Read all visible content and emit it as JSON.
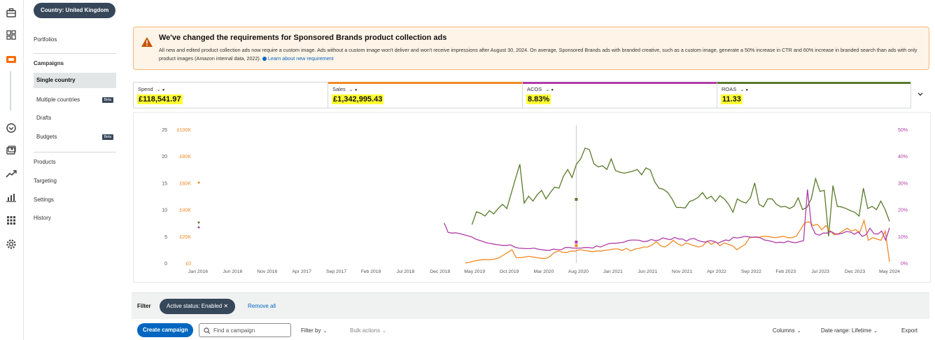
{
  "rail": {
    "icons": [
      "briefcase-icon",
      "dashboard-icon",
      "campaign-manager-icon",
      "shield-icon",
      "media-icon",
      "trending-icon",
      "bar-chart-icon",
      "apps-grid-icon",
      "settings-icon"
    ],
    "active_color": "#ff6a00"
  },
  "sidebar": {
    "country_pill": "Country: United Kingdom",
    "portfolios": "Portfolios",
    "campaigns_header": "Campaigns",
    "items": [
      {
        "label": "Single country",
        "selected": true
      },
      {
        "label": "Multiple countries",
        "badge": "Beta"
      },
      {
        "label": "Drafts"
      },
      {
        "label": "Budgets",
        "badge": "Beta"
      }
    ],
    "lower": [
      "Products",
      "Targeting",
      "Settings",
      "History"
    ]
  },
  "banner": {
    "title": "We've changed the requirements for Sponsored Brands product collection ads",
    "text": "All new and edited product collection ads now require a custom image. Ads without a custom image won't deliver and won't receive impressions after August 30, 2024. On average, Sponsored Brands ads with branded creative, such as a custom image, generate a 50% increase in CTR and 60% increase in branded search than ads with only product images (Amazon internal data, 2022).",
    "link": "Learn about new requirement",
    "accent": "#f5b87a",
    "background": "#fff4e8"
  },
  "metrics": [
    {
      "label": "Spend",
      "value": "£118,541.97",
      "color": "#ffffff"
    },
    {
      "label": "Sales",
      "value": "£1,342,995.43",
      "color": "#f08a24"
    },
    {
      "label": "ACOS",
      "value": "8.83%",
      "color": "#b03ca8"
    },
    {
      "label": "ROAS",
      "value": "11.33",
      "color": "#5a7a2a"
    }
  ],
  "chart_data": {
    "type": "line",
    "x_labels": [
      "Jan 2016",
      "Jun 2016",
      "Nov 2016",
      "Apr 2017",
      "Sep 2017",
      "Feb 2018",
      "Jul 2018",
      "Dec 2018",
      "May 2019",
      "Oct 2019",
      "Mar 2020",
      "Aug 2020",
      "Jan 2021",
      "Jun 2021",
      "Nov 2021",
      "Apr 2022",
      "Sep 2022",
      "Feb 2023",
      "Jul 2023",
      "Dec 2023",
      "May 2024"
    ],
    "left_axis_roas": [
      "25",
      "20",
      "15",
      "10",
      "5",
      "0"
    ],
    "left_axis_sales": [
      "£100K",
      "£80K",
      "£60K",
      "£40K",
      "£20K",
      "£0"
    ],
    "right_axis_acos": [
      "50%",
      "40%",
      "30%",
      "20%",
      "10%",
      "0%"
    ],
    "ylim_roas": [
      0,
      25
    ],
    "ylim_sales": [
      0,
      100000
    ],
    "ylim_acos": [
      0,
      50
    ],
    "series": [
      {
        "name": "ROAS",
        "color": "#5a7a2a",
        "values": [
          null,
          null,
          null,
          null,
          null,
          null,
          null,
          null,
          null,
          null,
          null,
          null,
          null,
          null,
          null,
          null,
          null,
          null,
          null,
          null,
          null,
          null,
          null,
          null,
          null,
          null,
          null,
          null,
          null,
          null,
          null,
          null,
          null,
          null,
          null,
          null,
          null,
          null,
          null,
          null,
          null,
          null,
          null,
          null,
          null,
          null,
          null,
          null,
          null,
          null,
          null,
          null,
          null,
          null,
          null,
          null,
          null,
          null,
          null,
          null,
          null,
          null,
          null,
          7.2,
          9.6,
          9.3,
          8.8,
          9.8,
          9.2,
          10.2,
          11.0,
          10.2,
          13.0,
          15.8,
          18.5,
          11.2,
          12.5,
          11.6,
          12.8,
          13.6,
          12.0,
          13.2,
          14.2,
          14.0,
          16.2,
          17.5,
          16.0,
          18.5,
          19.5,
          21.5,
          21.2,
          18.6,
          18.0,
          18.2,
          17.5,
          19.5,
          17.3,
          17.0,
          16.8,
          17.0,
          17.2,
          17.5,
          16.5,
          17.8,
          17.4,
          15.2,
          14.0,
          13.8,
          13.2,
          12.0,
          10.4,
          10.4,
          10.3,
          11.5,
          11.8,
          12.3,
          13.2,
          12.0,
          12.5,
          11.5,
          12.6,
          12.0,
          11.0,
          9.5,
          12.0,
          11.5,
          11.2,
          12.2,
          15.0,
          11.0,
          10.5,
          12.0,
          12.0,
          11.0,
          10.5,
          10.6,
          10.2,
          10.6,
          12.2,
          10.0,
          10.4,
          12.0,
          15.8,
          13.4,
          13.6,
          5.0,
          14.5,
          10.6,
          10.5,
          10.2,
          9.8,
          9.5,
          8.8,
          14.0,
          10.2,
          10.6,
          10.0,
          11.6,
          10.0,
          7.8
        ]
      },
      {
        "name": "Sales",
        "color": "#f08a24",
        "values": [
          null,
          null,
          null,
          null,
          null,
          null,
          null,
          null,
          null,
          null,
          null,
          null,
          null,
          null,
          null,
          null,
          null,
          null,
          null,
          null,
          null,
          null,
          null,
          null,
          null,
          null,
          null,
          null,
          null,
          null,
          null,
          null,
          null,
          null,
          null,
          null,
          null,
          null,
          null,
          null,
          null,
          null,
          null,
          null,
          null,
          null,
          null,
          null,
          null,
          null,
          null,
          null,
          null,
          null,
          null,
          null,
          null,
          null,
          null,
          null,
          null,
          null,
          null,
          0,
          500,
          1500,
          2000,
          2500,
          2500,
          2500,
          3000,
          4000,
          6000,
          8000,
          10000,
          4000,
          4000,
          4500,
          5000,
          4500,
          4000,
          3500,
          3500,
          5000,
          8000,
          9000,
          8000,
          8000,
          9000,
          9000,
          10000,
          9500,
          9000,
          8500,
          9000,
          9000,
          9500,
          10000,
          10500,
          10500,
          9500,
          11000,
          9000,
          10500,
          11000,
          12000,
          12000,
          13500,
          16000,
          13000,
          12000,
          14000,
          17000,
          14500,
          13000,
          15000,
          14000,
          13000,
          12000,
          13000,
          16500,
          14000,
          16000,
          13000,
          15000,
          14000,
          13000,
          10000,
          12000,
          14000,
          19000,
          19500,
          19000,
          20000,
          20000,
          19500,
          19000,
          19500,
          20000,
          19000,
          19000,
          20000,
          25000,
          30000,
          31000,
          28000,
          29000,
          25000,
          28000,
          24000,
          21000,
          22000,
          24000,
          26000,
          24000,
          25000,
          23000,
          32000,
          17000,
          19000,
          18000,
          17000,
          24000,
          1000
        ]
      },
      {
        "name": "ACOS",
        "color": "#b03ca8",
        "values": [
          null,
          null,
          null,
          null,
          null,
          null,
          null,
          null,
          null,
          null,
          null,
          null,
          null,
          null,
          null,
          null,
          null,
          null,
          null,
          null,
          null,
          null,
          null,
          null,
          null,
          null,
          null,
          null,
          null,
          null,
          null,
          null,
          null,
          null,
          null,
          null,
          null,
          null,
          null,
          null,
          null,
          null,
          null,
          null,
          null,
          null,
          null,
          null,
          null,
          null,
          null,
          null,
          null,
          null,
          null,
          null,
          null,
          null,
          null,
          null,
          null,
          null,
          null,
          15.0,
          11.5,
          11.2,
          11.3,
          11.0,
          10.6,
          10.2,
          9.8,
          9.0,
          8.5,
          8.0,
          7.5,
          7.3,
          7.0,
          6.8,
          6.6,
          6.6,
          6.8,
          6.0,
          5.6,
          5.5,
          5.4,
          5.4,
          5.6,
          5.2,
          5.0,
          4.8,
          4.8,
          5.2,
          5.0,
          5.0,
          5.8,
          5.8,
          5.6,
          5.6,
          5.6,
          5.8,
          5.8,
          5.6,
          6.4,
          6.0,
          6.6,
          7.2,
          7.4,
          7.4,
          7.6,
          7.8,
          8.4,
          8.6,
          8.6,
          8.5,
          8.0,
          8.2,
          8.8,
          8.4,
          8.6,
          9.4,
          9.0,
          8.8,
          9.6,
          9.0,
          9.0,
          8.2,
          9.0,
          9.2,
          8.4,
          8.0,
          7.8,
          8.4,
          8.2,
          7.4,
          8.0,
          8.6,
          8.4,
          9.6,
          9.4,
          9.6,
          10.0,
          9.8,
          9.6,
          9.8,
          9.4,
          8.6,
          8.4,
          8.0,
          7.6,
          7.8,
          7.6,
          8.2,
          7.8,
          7.6,
          8.0,
          8.4,
          27.5,
          14.0,
          11.0,
          10.4,
          11.2,
          11.2,
          11.8,
          11.0,
          10.8,
          11.2,
          11.8,
          11.6,
          10.8,
          11.6,
          10.0,
          10.6,
          13.0,
          11.0,
          10.8,
          12.0,
          8.6,
          13.2
        ]
      }
    ],
    "crosshair_x_label": "Aug 2020"
  },
  "filter": {
    "label": "Filter",
    "chip": "Active status: Enabled ✕",
    "remove_all": "Remove all"
  },
  "toolbar": {
    "create": "Create campaign",
    "search_placeholder": "Find a campaign",
    "filter_by": "Filter by",
    "bulk": "Bulk actions",
    "columns": "Columns",
    "date_range": "Date range: Lifetime",
    "export": "Export"
  }
}
